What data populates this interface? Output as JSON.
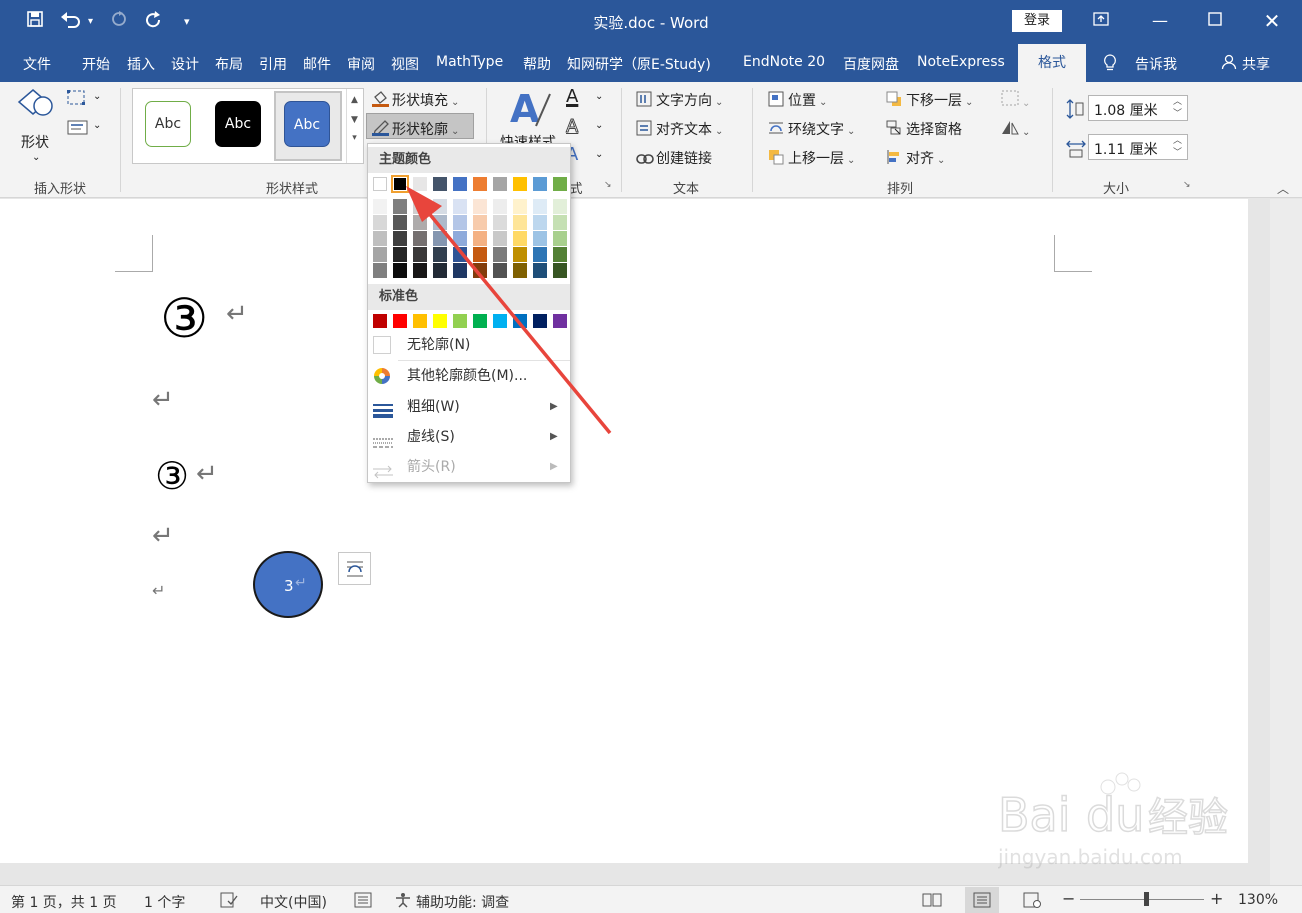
{
  "window": {
    "title": "实验.doc  -  Word",
    "login": "登录"
  },
  "tabs": [
    "文件",
    "开始",
    "插入",
    "设计",
    "布局",
    "引用",
    "邮件",
    "审阅",
    "视图",
    "MathType",
    "帮助",
    "知网研学（原E-Study)",
    "EndNote 20",
    "百度网盘",
    "NoteExpress",
    "格式"
  ],
  "tell_me": "告诉我",
  "share": "共享",
  "ribbon": {
    "shapes_label": "形状",
    "insert_shapes_group": "插入形状",
    "style_previews": [
      "Abc",
      "Abc",
      "Abc"
    ],
    "shape_styles_group": "形状样式",
    "shape_fill": "形状填充",
    "shape_outline": "形状轮廓",
    "quick_styles": "快速样式",
    "art_group_tail": "式",
    "text_direction": "文字方向",
    "align_text": "对齐文本",
    "create_link": "创建链接",
    "text_group": "文本",
    "position": "位置",
    "wrap_text": "环绕文字",
    "bring_forward": "上移一层",
    "send_backward": "下移一层",
    "selection_pane": "选择窗格",
    "align": "对齐",
    "arrange_group": "排列",
    "height": "1.08 厘米",
    "width": "1.11 厘米",
    "size_group": "大小"
  },
  "menu": {
    "theme_header": "主题颜色",
    "standard_header": "标准色",
    "no_outline": "无轮廓(N)",
    "more_colors": "其他轮廓颜色(M)...",
    "weight": "粗细(W)",
    "dashes": "虚线(S)",
    "arrows": "箭头(R)",
    "theme_top": [
      "#ffffff",
      "#000000",
      "#e7e6e6",
      "#44546a",
      "#4472c4",
      "#ed7d31",
      "#a5a5a5",
      "#ffc000",
      "#5b9bd5",
      "#70ad47"
    ],
    "theme_shades": [
      [
        "#f2f2f2",
        "#7f7f7f",
        "#d0cece",
        "#d6dce4",
        "#d9e2f3",
        "#fbe5d5",
        "#ededed",
        "#fff2cc",
        "#deebf6",
        "#e2efd9"
      ],
      [
        "#d8d8d8",
        "#595959",
        "#aeabab",
        "#adb9ca",
        "#b4c6e7",
        "#f7cbac",
        "#dbdbdb",
        "#fee599",
        "#bdd7ee",
        "#c5e0b3"
      ],
      [
        "#bfbfbf",
        "#3f3f3f",
        "#757070",
        "#8496b0",
        "#8eaadb",
        "#f4b183",
        "#c9c9c9",
        "#ffd965",
        "#9cc3e5",
        "#a8d08d"
      ],
      [
        "#a5a5a5",
        "#262626",
        "#3a3838",
        "#323f4f",
        "#2f5496",
        "#c55a11",
        "#7b7b7b",
        "#bf8f00",
        "#2e75b5",
        "#538135"
      ],
      [
        "#7f7f7f",
        "#0c0c0c",
        "#171616",
        "#222a35",
        "#1f3864",
        "#833c0b",
        "#525252",
        "#7f6000",
        "#1e4e79",
        "#375623"
      ]
    ],
    "standard": [
      "#c00000",
      "#ff0000",
      "#ffc000",
      "#ffff00",
      "#92d050",
      "#00b050",
      "#00b0f0",
      "#0070c0",
      "#002060",
      "#7030a0"
    ]
  },
  "document": {
    "circled1": "③",
    "circled2": "③",
    "circle_text": "3"
  },
  "status": {
    "page": "第 1 页，共 1 页",
    "words": "1 个字",
    "lang": "中文(中国)",
    "access": "辅助功能: 调查",
    "zoom": "130%"
  },
  "colors": {
    "accent": "#2b579a",
    "circle_fill": "#4472c4",
    "arrow": "#e8453c"
  }
}
